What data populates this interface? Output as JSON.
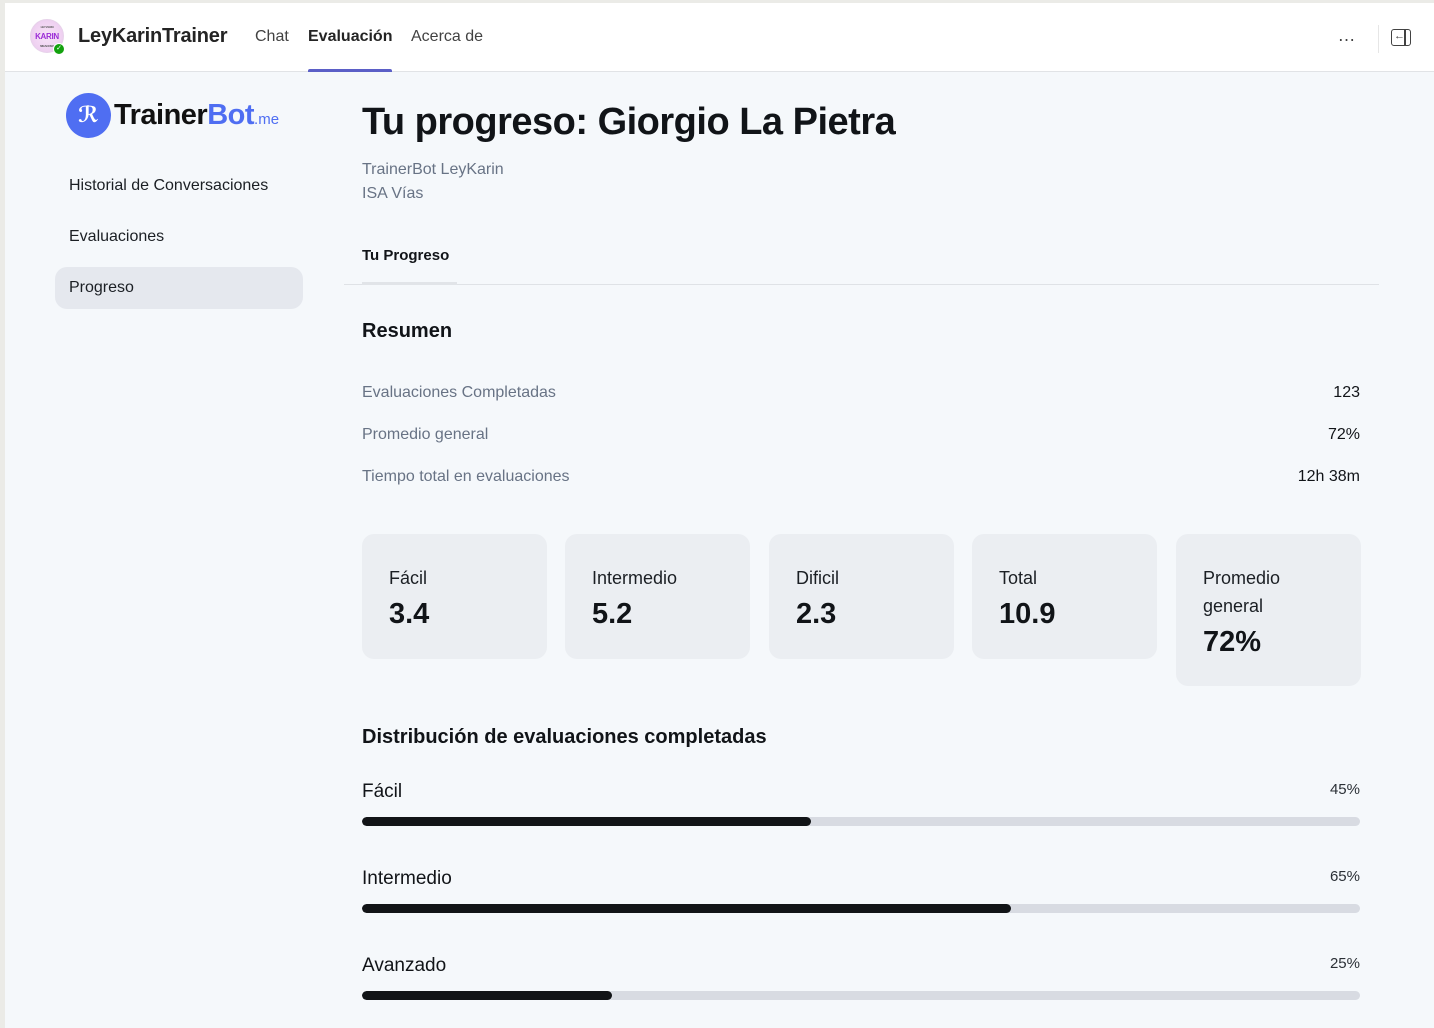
{
  "header": {
    "app_name": "LeyKarinTrainer",
    "avatar_text": "KARIN",
    "tabs": [
      {
        "label": "Chat",
        "active": false
      },
      {
        "label": "Evaluación",
        "active": true
      },
      {
        "label": "Acerca de",
        "active": false
      }
    ],
    "more_icon": "…",
    "panel_icon": "open-panel-icon",
    "accent_color": "#5b5fc7"
  },
  "sidebar": {
    "brand": {
      "name_dark": "Trainer",
      "name_blue": "Bot",
      "suffix": ".me",
      "brand_color": "#4f6ef2"
    },
    "items": [
      {
        "label": "Historial de Conversaciones",
        "active": false
      },
      {
        "label": "Evaluaciones",
        "active": false
      },
      {
        "label": "Progreso",
        "active": true
      }
    ]
  },
  "main": {
    "title": "Tu progreso: Giorgio La Pietra",
    "subtitle_lines": [
      "TrainerBot LeyKarin",
      "ISA Vías"
    ],
    "tabs": [
      {
        "label": "Tu Progreso",
        "active": true
      }
    ],
    "summary": {
      "title": "Resumen",
      "rows": [
        {
          "label": "Evaluaciones Completadas",
          "value": "123"
        },
        {
          "label": "Promedio general",
          "value": "72%"
        },
        {
          "label": "Tiempo total en evaluaciones",
          "value": "12h 38m"
        }
      ]
    },
    "stats": [
      {
        "label": "Fácil",
        "value": "3.4"
      },
      {
        "label": "Intermedio",
        "value": "5.2"
      },
      {
        "label": "Dificil",
        "value": "2.3"
      },
      {
        "label": "Total",
        "value": "10.9"
      },
      {
        "label": "Promedio general",
        "value": "72%"
      }
    ],
    "distribution": {
      "title": "Distribución de evaluaciones completadas",
      "items": [
        {
          "label": "Fácil",
          "percent_text": "45%",
          "percent": 45
        },
        {
          "label": "Intermedio",
          "percent_text": "65%",
          "percent": 65
        },
        {
          "label": "Avanzado",
          "percent_text": "25%",
          "percent": 25
        }
      ]
    }
  }
}
